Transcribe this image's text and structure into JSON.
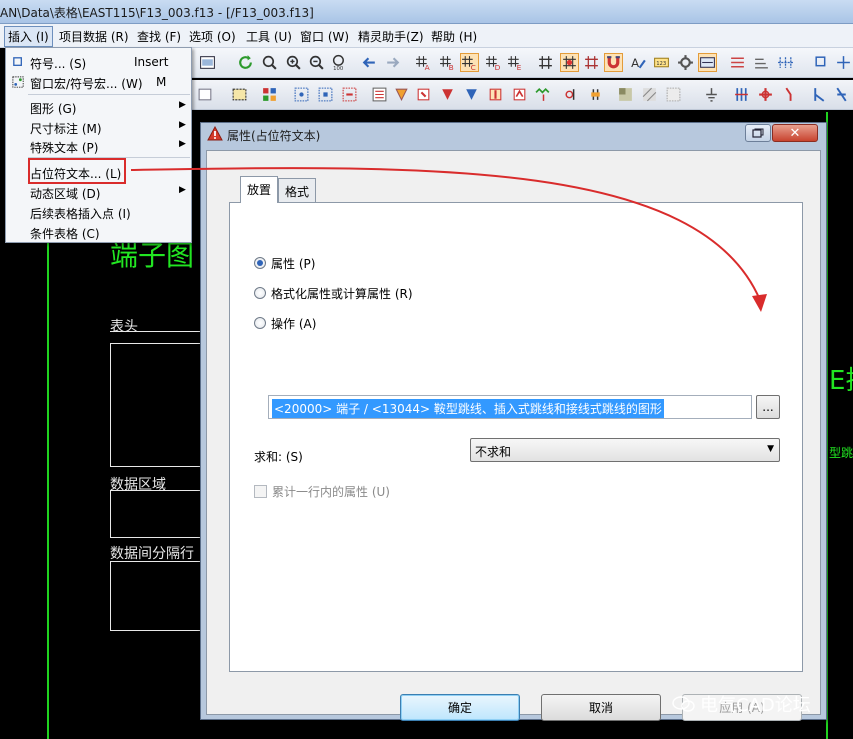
{
  "window": {
    "title": "AN\\Data\\表格\\EAST115\\F13_003.f13 - [/F13_003.f13]"
  },
  "menubar": {
    "items": [
      {
        "label": "插入 (I)",
        "active": true
      },
      {
        "label": "项目数据 (R)"
      },
      {
        "label": "查找 (F)"
      },
      {
        "label": "选项 (O)"
      },
      {
        "label": "工具 (U)"
      },
      {
        "label": "窗口 (W)"
      },
      {
        "label": "精灵助手(Z)"
      },
      {
        "label": "帮助 (H)"
      }
    ]
  },
  "insert_menu": {
    "items": [
      {
        "label": "符号... (S)",
        "shortcut": "Insert"
      },
      {
        "label": "窗口宏/符号宏... (W)",
        "shortcut": "M"
      },
      {
        "label": "图形 (G)"
      },
      {
        "label": "尺寸标注 (M)"
      },
      {
        "label": "特殊文本 (P)"
      },
      {
        "label": "占位符文本... (L)"
      },
      {
        "label": "动态区域 (D)"
      },
      {
        "label": "后续表格插入点 (I)"
      },
      {
        "label": "条件表格 (C)"
      }
    ]
  },
  "canvas": {
    "title_text": "端子图",
    "labels": [
      "表头",
      "数据区域",
      "数据间分隔行"
    ],
    "side_text": "E排",
    "side_small": "型跳"
  },
  "dialog": {
    "title": "属性(占位符文本)",
    "tabs": [
      "放置",
      "格式"
    ],
    "radio_property": "属性 (P)",
    "radio_format": "格式化属性或计算属性 (R)",
    "radio_action": "操作 (A)",
    "field_value": "<20000> 端子 / <13044> 鞍型跳线、插入式跳线和接线式跳线的图形",
    "browse_label": "...",
    "sum_label": "求和: (S)",
    "sum_value": "不求和",
    "cumulate_label": "累计一行内的属性 (U)",
    "ok_label": "确定",
    "cancel_label": "取消",
    "apply_label": "应用 (A)"
  },
  "watermark": {
    "text": "电气CAD论坛"
  },
  "colors": {
    "cad_green": "#1fd31f",
    "highlight_red": "#d92c2c",
    "selection_blue": "#3399ff"
  }
}
